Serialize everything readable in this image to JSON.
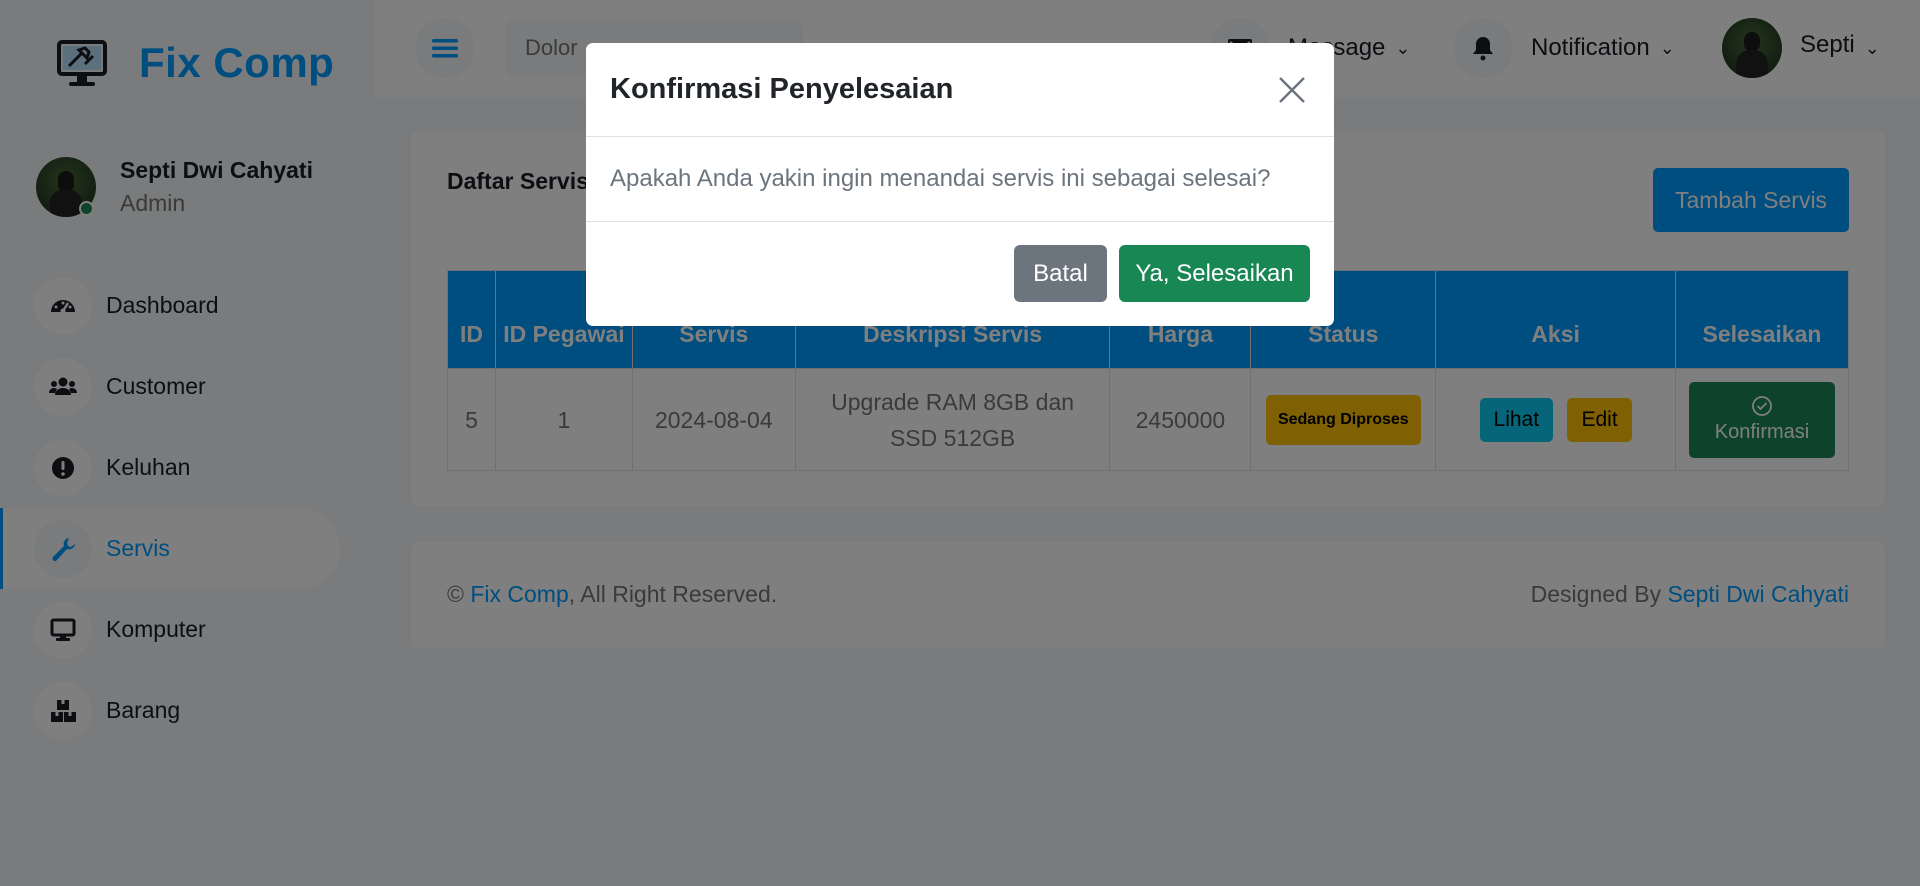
{
  "brand": {
    "name": "Fix Comp",
    "logo_icon": "monitor-tools-icon",
    "color": "#009cff"
  },
  "profile": {
    "name": "Septi Dwi Cahyati",
    "role": "Admin",
    "status": "online"
  },
  "nav": {
    "items": [
      {
        "label": "Dashboard",
        "icon": "dashboard-icon"
      },
      {
        "label": "Customer",
        "icon": "users-icon"
      },
      {
        "label": "Keluhan",
        "icon": "exclamation-icon"
      },
      {
        "label": "Servis",
        "icon": "wrench-icon",
        "active": true
      },
      {
        "label": "Komputer",
        "icon": "monitor-icon"
      },
      {
        "label": "Barang",
        "icon": "boxes-icon"
      }
    ]
  },
  "topbar": {
    "search_value": "Dolor",
    "message_label": "Message",
    "notification_label": "Notification",
    "user_label": "Septi"
  },
  "main": {
    "title": "Daftar Servis",
    "add_button": "Tambah Servis",
    "table": {
      "headers": [
        "ID",
        "ID Pegawai",
        "Servis",
        "Deskripsi Servis",
        "Harga",
        "Status",
        "Aksi",
        "Selesaikan"
      ],
      "rows": [
        {
          "id": "5",
          "id_pegawai": "1",
          "tanggal": "2024-08-04",
          "deskripsi": "Upgrade RAM 8GB dan SSD 512GB",
          "harga": "2450000",
          "status": "Sedang Diproses",
          "view_label": "Lihat",
          "edit_label": "Edit",
          "confirm_label": "Konfirmasi"
        }
      ]
    }
  },
  "footer": {
    "copyright_prefix": "©",
    "brand_link": "Fix Comp",
    "rights": ", All Right Reserved.",
    "designed_by": "Designed By",
    "designer_link": "Septi Dwi Cahyati"
  },
  "modal": {
    "title": "Konfirmasi Penyelesaian",
    "message": "Apakah Anda yakin ingin menandai servis ini sebagai selesai?",
    "cancel_label": "Batal",
    "confirm_label": "Ya, Selesaikan"
  },
  "colors": {
    "primary": "#009cff",
    "success": "#198754",
    "secondary": "#6c757d",
    "warning": "#ffc107",
    "info": "#0dcaf0"
  }
}
